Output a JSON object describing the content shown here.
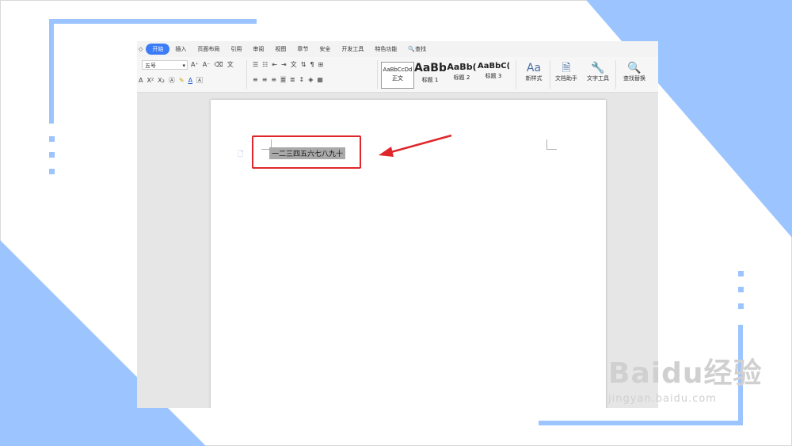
{
  "colors": {
    "accent": "#3c7cf6",
    "annotation": "#e0262a",
    "decor": "#9cc5ff"
  },
  "menu": {
    "items": [
      {
        "label": "开始",
        "active": true
      },
      {
        "label": "插入"
      },
      {
        "label": "页面布局"
      },
      {
        "label": "引用"
      },
      {
        "label": "审阅"
      },
      {
        "label": "视图"
      },
      {
        "label": "章节"
      },
      {
        "label": "安全"
      },
      {
        "label": "开发工具"
      },
      {
        "label": "特色功能"
      }
    ],
    "search_label": "查找"
  },
  "ribbon": {
    "font_size": "五号",
    "styles": [
      {
        "sample": "AaBbCcDd",
        "caption": "正文"
      },
      {
        "sample": "AaBb",
        "caption": "标题 1"
      },
      {
        "sample": "AaBb(",
        "caption": "标题 2"
      },
      {
        "sample": "AaBbC(",
        "caption": "标题 3"
      }
    ],
    "new_style": "新样式",
    "doc_assistant": "文档助手",
    "text_tools": "文字工具",
    "find_replace": "查找替换"
  },
  "document": {
    "selected_text": "一二三四五六七八九十"
  },
  "watermark": {
    "brand": "Baidu经验",
    "url": "jingyan.baidu.com"
  }
}
